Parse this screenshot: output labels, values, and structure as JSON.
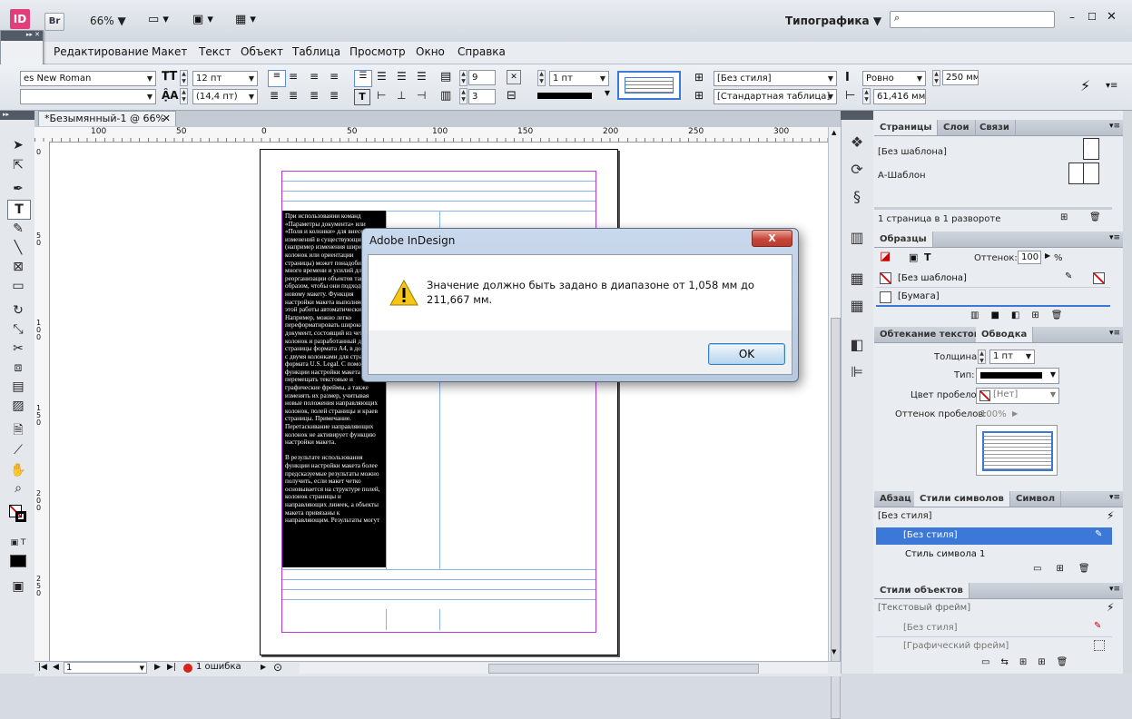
{
  "appbar": {
    "logo": "ID",
    "bridge": "Br",
    "zoom": "66%",
    "workspace": "Типографика",
    "search_placeholder": "",
    "menu": [
      "Редактирование",
      "Макет",
      "Текст",
      "Объект",
      "Таблица",
      "Просмотр",
      "Окно",
      "Справка"
    ]
  },
  "control": {
    "font_name": "es New Roman",
    "font_style": "",
    "font_size": "12 пт",
    "leading": "(14,4 пт)",
    "rows": "9",
    "cols": "3",
    "stroke_weight": "1 пт",
    "cell_style": "[Без стиля]",
    "table_style": "[Стандартная таблица]",
    "row_height_mode": "Ровно",
    "row_height": "250 мм",
    "col_width": "61,416 мм"
  },
  "document": {
    "tab_title": "*Безымянный-1 @ 66%",
    "ruler_h": [
      "100",
      "50",
      "0",
      "50",
      "100",
      "150",
      "200",
      "250",
      "300"
    ],
    "ruler_v": [
      "0",
      "5\n0",
      "1\n0\n0",
      "1\n5\n0",
      "2\n0\n0",
      "2\n5\n0"
    ],
    "text_block": "При использовании команд «Параметры документа» или «Поля и колонки» для внесения изменений в существующий макет (например изменения ширины колонок или ориентации страницы) может понадобиться много времени и усилий для реорганизации объектов таким образом, чтобы они подходили к новому макету. Функция настройки макета выполняет часть этой работы автоматически. Например, можно легко переформатировать широкий документ, состоящий из четырех колонок и разработанный для страницы формата A4, в документ с двумя колонками для страницы формата U.S. Legal. С помощью функции настройки макета можно перемещать текстовые и графические фреймы, а также изменять их размер, учитывая новые положения направляющих колонок, полей страницы и краев страницы. Примечание. Перетаскивание направляющих колонок не активирует функцию настройки макета.\n\nВ результате использования функции настройки макета более предсказуемые результаты можно получить, если макет четко основывается на структуре полей, колонок страницы и направляющих линеек, а объекты макета привязаны к направляющим. Результаты могут"
  },
  "status": {
    "page": "1",
    "errors": "1 ошибка"
  },
  "dialog": {
    "title": "Adobe InDesign",
    "message": "Значение должно быть задано в диапазоне от 1,058 мм до 211,667 мм.",
    "ok_label": "OK",
    "close_label": "X"
  },
  "panels": {
    "pages": {
      "tabs": [
        "Страницы",
        "Слои",
        "Связи"
      ],
      "none_master": "[Без шаблона]",
      "a_master": "А-Шаблон",
      "footer": "1 страница в 1 развороте"
    },
    "swatches": {
      "tab": "Образцы",
      "tint_label": "Оттенок:",
      "tint_value": "100",
      "tint_unit": "%",
      "items": [
        "[Без шаблона]",
        "[Бумага]"
      ]
    },
    "stroke": {
      "tabs": [
        "Обтекание текстом",
        "Обводка"
      ],
      "weight_label": "Толщина:",
      "weight_value": "1 пт",
      "type_label": "Тип:",
      "gap_color_label": "Цвет пробелов:",
      "gap_color_value": "[Нет]",
      "gap_tint_label": "Оттенок пробелов:",
      "gap_tint_value": "100%"
    },
    "char_styles": {
      "tabs": [
        "Абзац",
        "Стили символов",
        "Символ"
      ],
      "current": "[Без стиля]",
      "items": [
        "[Без стиля]",
        "Стиль символа 1"
      ]
    },
    "object_styles": {
      "tab": "Стили объектов",
      "current": "[Текстовый фрейм]",
      "items": [
        "[Без стиля]",
        "[Графический фрейм]"
      ]
    }
  },
  "colors": {
    "accent": "#3b78d8",
    "margin_purple": "#b23ad6",
    "dialog_border": "#c0433c"
  }
}
